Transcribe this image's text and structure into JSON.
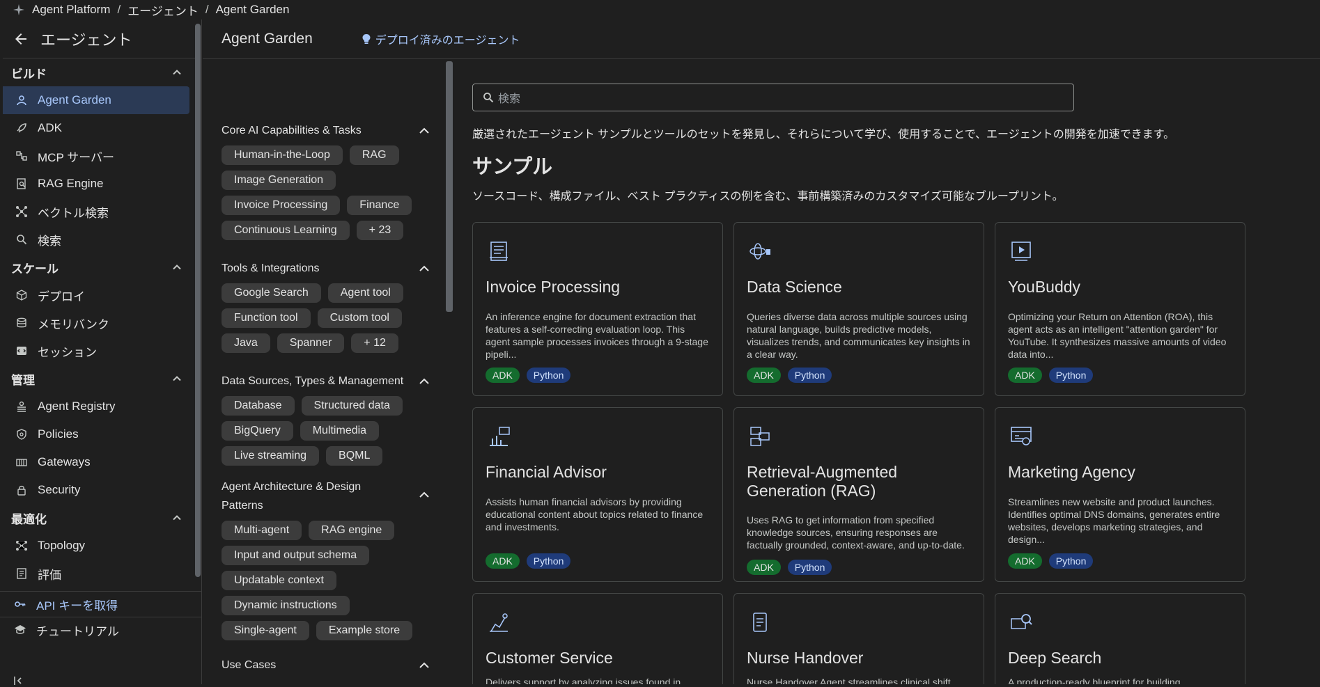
{
  "breadcrumb": [
    "Agent Platform",
    "エージェント",
    "Agent Garden"
  ],
  "sidebar": {
    "title": "エージェント",
    "sections": [
      {
        "label": "ビルド",
        "items": [
          {
            "label": "Agent Garden",
            "icon": "agent-garden-icon",
            "active": true
          },
          {
            "label": "ADK",
            "icon": "rocket-icon"
          },
          {
            "label": "MCP サーバー",
            "icon": "mcp-icon"
          },
          {
            "label": "RAG Engine",
            "icon": "rag-engine-icon"
          },
          {
            "label": "ベクトル検索",
            "icon": "vector-search-icon"
          },
          {
            "label": "検索",
            "icon": "search-icon"
          }
        ]
      },
      {
        "label": "スケール",
        "items": [
          {
            "label": "デプロイ",
            "icon": "deploy-icon"
          },
          {
            "label": "メモリバンク",
            "icon": "memory-bank-icon"
          },
          {
            "label": "セッション",
            "icon": "session-icon"
          }
        ]
      },
      {
        "label": "管理",
        "items": [
          {
            "label": "Agent Registry",
            "icon": "registry-icon"
          },
          {
            "label": "Policies",
            "icon": "policies-icon"
          },
          {
            "label": "Gateways",
            "icon": "gateways-icon"
          },
          {
            "label": "Security",
            "icon": "lock-icon"
          }
        ]
      },
      {
        "label": "最適化",
        "items": [
          {
            "label": "Topology",
            "icon": "topology-icon"
          },
          {
            "label": "評価",
            "icon": "evaluation-icon"
          }
        ]
      }
    ],
    "api_key": "API キーを取得",
    "tutorial": "チュートリアル"
  },
  "header": {
    "title": "Agent Garden",
    "deployed_link": "デプロイ済みのエージェント"
  },
  "filters": {
    "groups": [
      {
        "title": "Core AI Capabilities & Tasks",
        "chips": [
          "Human-in-the-Loop",
          "RAG",
          "Image Generation",
          "Invoice Processing",
          "Finance",
          "Continuous Learning",
          "+ 23"
        ]
      },
      {
        "title": "Tools & Integrations",
        "chips": [
          "Google Search",
          "Agent tool",
          "Function tool",
          "Custom tool",
          "Java",
          "Spanner",
          "+ 12"
        ]
      },
      {
        "title": "Data Sources, Types & Management",
        "chips": [
          "Database",
          "Structured data",
          "BigQuery",
          "Multimedia",
          "Live streaming",
          "BQML"
        ]
      },
      {
        "title": "Agent Architecture & Design Patterns",
        "chips": [
          "Multi-agent",
          "RAG engine",
          "Input and output schema",
          "Updatable context",
          "Dynamic instructions",
          "Single-agent",
          "Example store"
        ]
      },
      {
        "title": "Use Cases",
        "chips": []
      }
    ]
  },
  "search": {
    "placeholder": "検索"
  },
  "intro": "厳選されたエージェント サンプルとツールのセットを発見し、それらについて学び、使用することで、エージェントの開発を加速できます。",
  "samples": {
    "title": "サンプル",
    "subtitle": "ソースコード、構成ファイル、ベスト プラクティスの例を含む、事前構築済みのカスタマイズ可能なブループリント。",
    "cards": [
      {
        "title": "Invoice Processing",
        "icon": "invoice-icon",
        "desc": "An inference engine for document extraction that features a self-correcting evaluation loop. This agent sample processes invoices through a 9-stage pipeli...",
        "tags": [
          "ADK",
          "Python"
        ]
      },
      {
        "title": "Data Science",
        "icon": "data-science-icon",
        "desc": "Queries diverse data across multiple sources using natural language, builds predictive models, visualizes trends, and communicates key insights in a clear way.",
        "tags": [
          "ADK",
          "Python"
        ]
      },
      {
        "title": "YouBuddy",
        "icon": "video-icon",
        "desc": "Optimizing your Return on Attention (ROA), this agent acts as an intelligent \"attention garden\" for YouTube. It synthesizes massive amounts of video data into...",
        "tags": [
          "ADK",
          "Python"
        ]
      },
      {
        "title": "Financial Advisor",
        "icon": "financial-icon",
        "desc": "Assists human financial advisors by providing educational content about topics related to finance and investments.",
        "tags": [
          "ADK",
          "Python"
        ]
      },
      {
        "title": "Retrieval-Augmented Generation (RAG)",
        "icon": "rag-icon",
        "desc": "Uses RAG to get information from specified knowledge sources, ensuring responses are factually grounded, context-aware, and up-to-date.",
        "tags": [
          "ADK",
          "Python"
        ]
      },
      {
        "title": "Marketing Agency",
        "icon": "marketing-icon",
        "desc": "Streamlines new website and product launches. Identifies optimal DNS domains, generates entire websites, develops marketing strategies, and design...",
        "tags": [
          "ADK",
          "Python"
        ]
      },
      {
        "title": "Customer Service",
        "icon": "customer-service-icon",
        "desc": "Delivers support by analyzing issues found in...",
        "tags": []
      },
      {
        "title": "Nurse Handover",
        "icon": "nurse-icon",
        "desc": "Nurse Handover Agent streamlines clinical shift...",
        "tags": []
      },
      {
        "title": "Deep Search",
        "icon": "deep-search-icon",
        "desc": "A production-ready blueprint for building...",
        "tags": []
      }
    ]
  }
}
